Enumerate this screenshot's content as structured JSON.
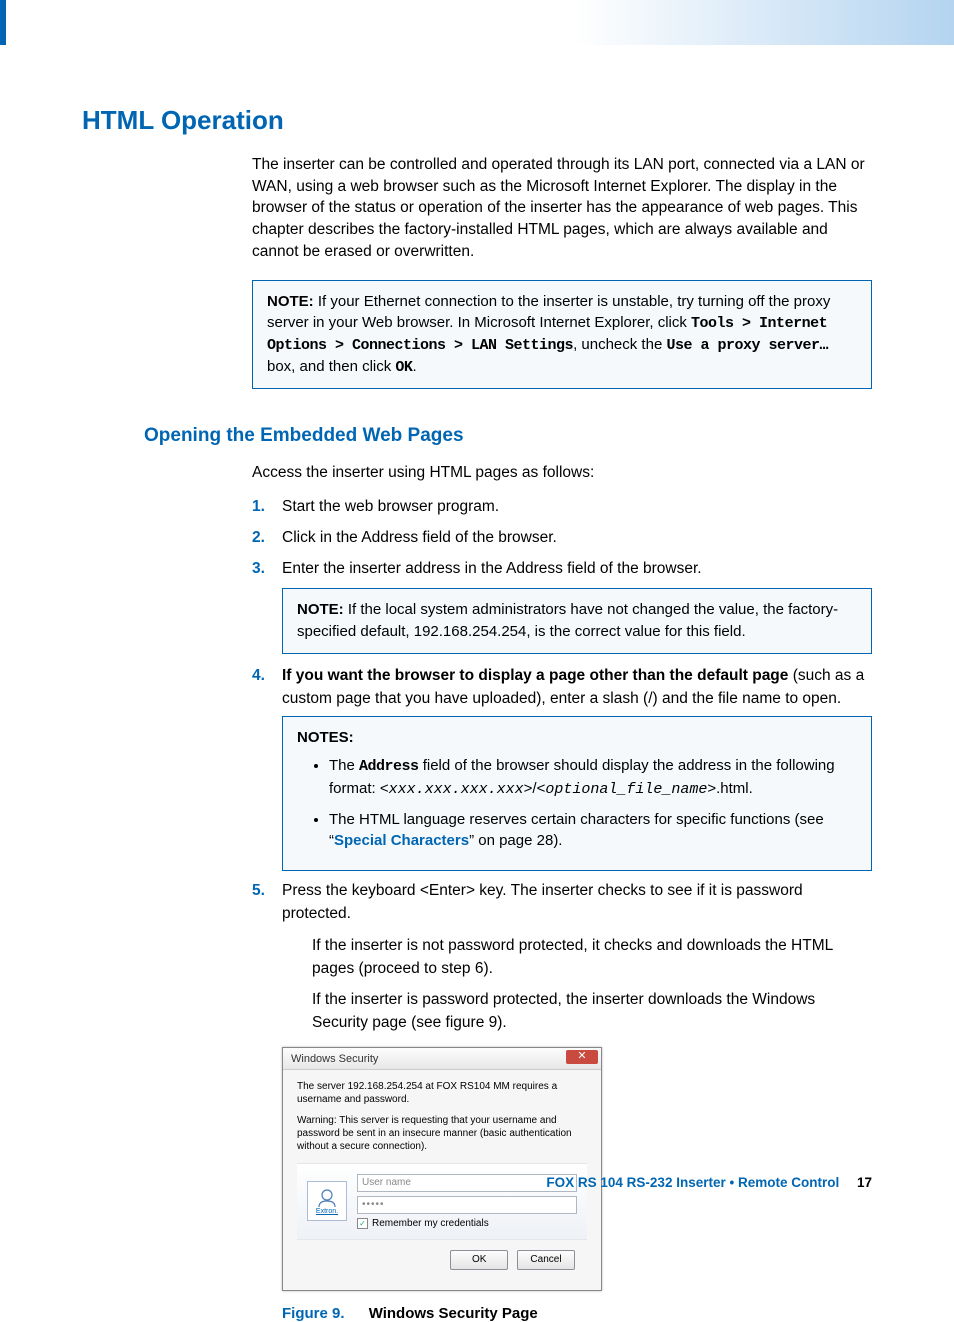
{
  "h1": "HTML Operation",
  "intro": "The inserter can be controlled and operated through its LAN port, connected via a LAN or WAN, using a web browser such as the Microsoft Internet Explorer. The display in the browser of the status or operation of the inserter has the appearance of web pages. This chapter describes the factory-installed HTML pages, which are always available and cannot be erased or overwritten.",
  "note1_label": "NOTE:",
  "note1_a": "If your Ethernet connection to the inserter is unstable, try turning off the proxy server in your Web browser. In Microsoft Internet Explorer, click ",
  "note1_path": "Tools > Internet Options > Connections > LAN Settings",
  "note1_b": ", uncheck the ",
  "note1_proxy": "Use a proxy server…",
  "note1_c": " box, and then click ",
  "note1_ok": "OK",
  "note1_d": ".",
  "h2": "Opening the Embedded Web Pages",
  "access": "Access the inserter using HTML pages as follows:",
  "steps": {
    "s1": "Start the web browser program.",
    "s2": "Click in the Address field of the browser.",
    "s3": "Enter the inserter address in the Address field of the browser.",
    "s4_bold": "If you want the browser to display a page other than the default page",
    "s4_rest": " (such as a custom page that you have uploaded), enter a slash (/) and the file name to open.",
    "s5_a": "Press the keyboard <Enter> key. The inserter checks to see if it is password protected.",
    "s5_b": "If the inserter is not password protected, it checks and downloads the HTML pages (proceed to step 6).",
    "s5_c": "If the inserter is password protected, the inserter downloads the Windows Security page (see figure 9)."
  },
  "note2_label": "NOTE:",
  "note2_text": "If the local system administrators have not changed the value, the factory-specified default, 192.168.254.254, is the correct value for this field.",
  "notes_label": "NOTES:",
  "notes_b1_a": "The ",
  "notes_b1_addr": "Address",
  "notes_b1_b": " field of the browser should display the address in the following format: <",
  "notes_b1_ip": "xxx.xxx.xxx.xxx",
  "notes_b1_c": ">/<",
  "notes_b1_fn": "optional_file_name",
  "notes_b1_d": ">.html.",
  "notes_b2_a": "The HTML language reserves certain characters for specific functions (see “",
  "notes_b2_link": "Special Characters",
  "notes_b2_b": "” on page 28).",
  "dialog": {
    "title": "Windows Security",
    "msg": "The server 192.168.254.254 at FOX RS104 MM requires a username and password.",
    "warn": "Warning: This server is requesting that your username and password be sent in an insecure manner (basic authentication without a secure connection).",
    "user_placeholder": "User name",
    "pwd_value": "•••••",
    "remember": "Remember my credentials",
    "avatar_label": "Extron.",
    "ok": "OK",
    "cancel": "Cancel"
  },
  "figure_label": "Figure 9.",
  "figure_title": "Windows Security Page",
  "footer_doc": "FOX RS 104 RS-232 Inserter • Remote Control",
  "footer_page": "17"
}
